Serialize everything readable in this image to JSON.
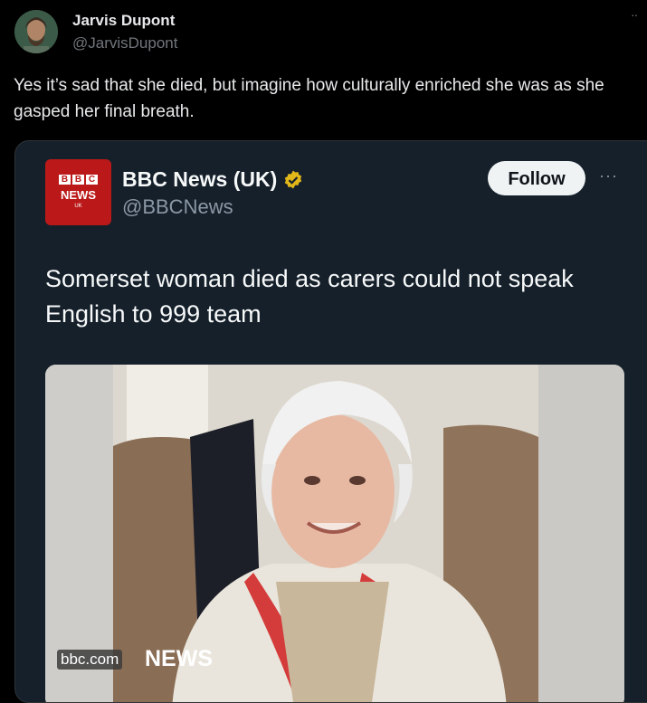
{
  "author": {
    "name": "Jarvis Dupont",
    "handle": "@JarvisDupont"
  },
  "tweet": {
    "text": "Yes it’s sad that she died, but imagine how culturally enriched she was as she gasped her final breath."
  },
  "quoted": {
    "logo": {
      "blocks": [
        "B",
        "B",
        "C"
      ],
      "news": "NEWS",
      "region": "UK"
    },
    "account_name": "BBC News (UK)",
    "account_handle": "@BBCNews",
    "follow_label": "Follow",
    "headline": "Somerset woman died as carers could not speak English to 999 team",
    "image": {
      "source_badge": "bbc.com",
      "news_label": "NEWS"
    }
  },
  "colors": {
    "background": "#000000",
    "card_background": "#15202b",
    "bbc_red": "#bb1919",
    "verified_gold": "#e2b719"
  },
  "icons": {
    "verified": "verified-badge-icon",
    "more": "more-options-icon"
  }
}
